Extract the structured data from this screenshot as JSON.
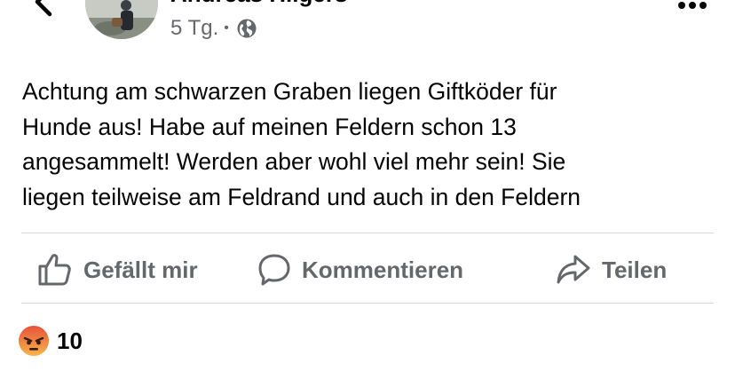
{
  "post": {
    "author": "Andreas Hilgers",
    "time": "5 Tg.",
    "audience_icon": "globe-icon",
    "text": "Achtung am schwarzen Graben liegen Giftköder für\nHunde aus! Habe auf meinen Feldern schon 13\nangesammelt! Werden aber wohl viel mehr sein! Sie\nliegen teilweise am Feldrand und auch in den Feldern"
  },
  "actions": {
    "like_label": "Gefällt mir",
    "comment_label": "Kommentieren",
    "share_label": "Teilen"
  },
  "reactions": {
    "icon": "angry-reaction-icon",
    "count": "10"
  },
  "colors": {
    "text": "#050505",
    "secondary": "#65676b",
    "divider": "#d7d8dc"
  }
}
